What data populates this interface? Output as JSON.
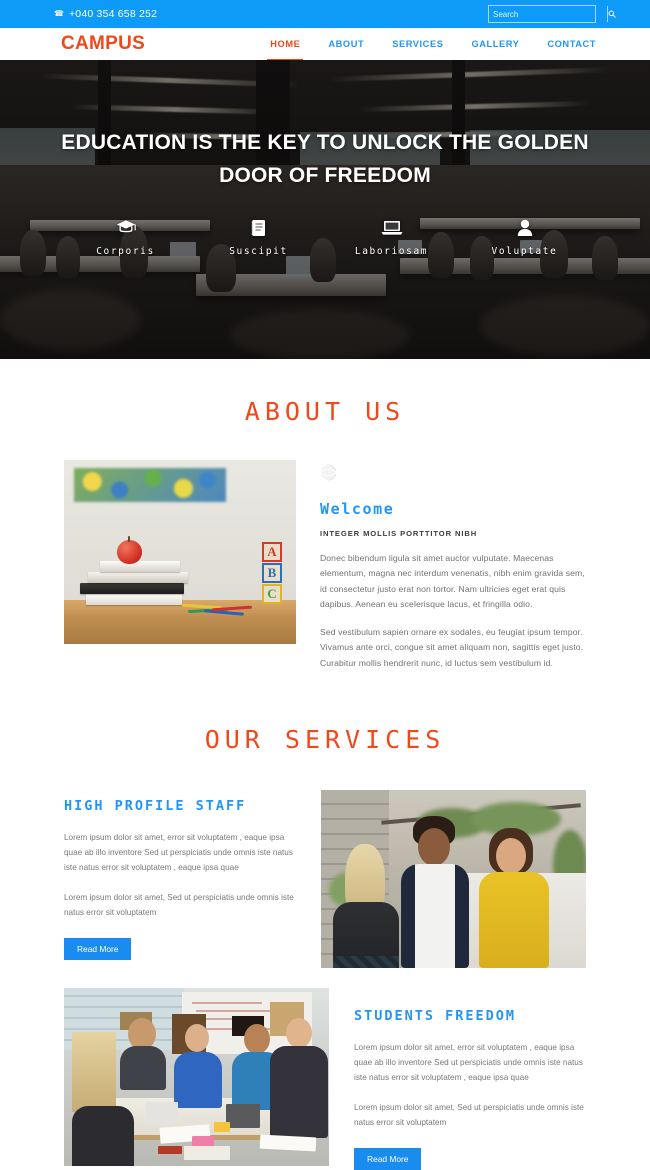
{
  "topbar": {
    "phone_icon": "phone-icon",
    "phone": "+040 354 658 252",
    "search_placeholder": "Search",
    "search_value": "",
    "search_icon": "search-icon"
  },
  "header": {
    "logo": "CAMPUS",
    "nav": [
      {
        "label": "HOME",
        "active": true
      },
      {
        "label": "ABOUT",
        "active": false
      },
      {
        "label": "SERVICES",
        "active": false
      },
      {
        "label": "GALLERY",
        "active": false
      },
      {
        "label": "CONTACT",
        "active": false
      }
    ]
  },
  "hero": {
    "title": "EDUCATION IS THE KEY TO UNLOCK THE GOLDEN DOOR OF FREEDOM",
    "features": [
      {
        "icon": "graduation-cap-icon",
        "label": "Corporis"
      },
      {
        "icon": "book-icon",
        "label": "Suscipit"
      },
      {
        "icon": "laptop-icon",
        "label": "Laboriosam"
      },
      {
        "icon": "user-icon",
        "label": "Voluptate"
      }
    ]
  },
  "about": {
    "section_title": "ABOUT US",
    "image_alt": "apple-on-books-photo",
    "icon": "globe-icon",
    "heading": "Welcome",
    "subheading": "INTEGER MOLLIS PORTTITOR NIBH",
    "paragraphs": [
      "Donec bibendum ligula sit amet auctor vulputate. Maecenas elementum, magna nec interdum venenatis, nibh enim gravida sem, id consectetur justo erat non tortor. Nam ultricies eget erat quis dapibus. Aenean eu scelerisque lacus, et fringilla odio.",
      "Sed vestibulum sapien ornare ex sodales, eu feugiat ipsum tempor. Vivamus ante orci, congue sit amet aliquam non, sagittis eget justo. Curabitur mollis hendrerit nunc, id luctus sem vestibulum id."
    ],
    "blocks": [
      "A",
      "B",
      "C"
    ]
  },
  "services": {
    "section_title": "OUR SERVICES",
    "items": [
      {
        "title": "HIGH PROFILE STAFF",
        "paragraph1": "Lorem ipsum dolor sit amet, error sit voluptatem , eaque ipsa quae ab illo inventore Sed ut perspiciatis unde omnis iste natus iste natus error sit voluptatem , eaque ipsa quae",
        "paragraph2": "Lorem ipsum dolor sit amet, Sed ut perspiciatis unde omnis iste natus error sit voluptatem",
        "button": "Read More",
        "image_alt": "three-students-talking-photo"
      },
      {
        "title": "STUDENTS FREEDOM",
        "paragraph1": "Lorem ipsum dolor sit amet, error sit voluptatem , eaque ipsa quae ab illo inventore Sed ut perspiciatis unde omnis iste natus iste natus error sit voluptatem , eaque ipsa quae",
        "paragraph2": "Lorem ipsum dolor sit amet, Sed ut perspiciatis unde omnis iste natus error sit voluptatem",
        "button": "Read More",
        "image_alt": "students-group-table-photo"
      }
    ]
  },
  "colors": {
    "accent_blue": "#0d9bf7",
    "accent_orange": "#f1481a",
    "nav_blue": "#2196f3",
    "button_blue": "#1a8cf0",
    "body_text": "#77797d"
  }
}
